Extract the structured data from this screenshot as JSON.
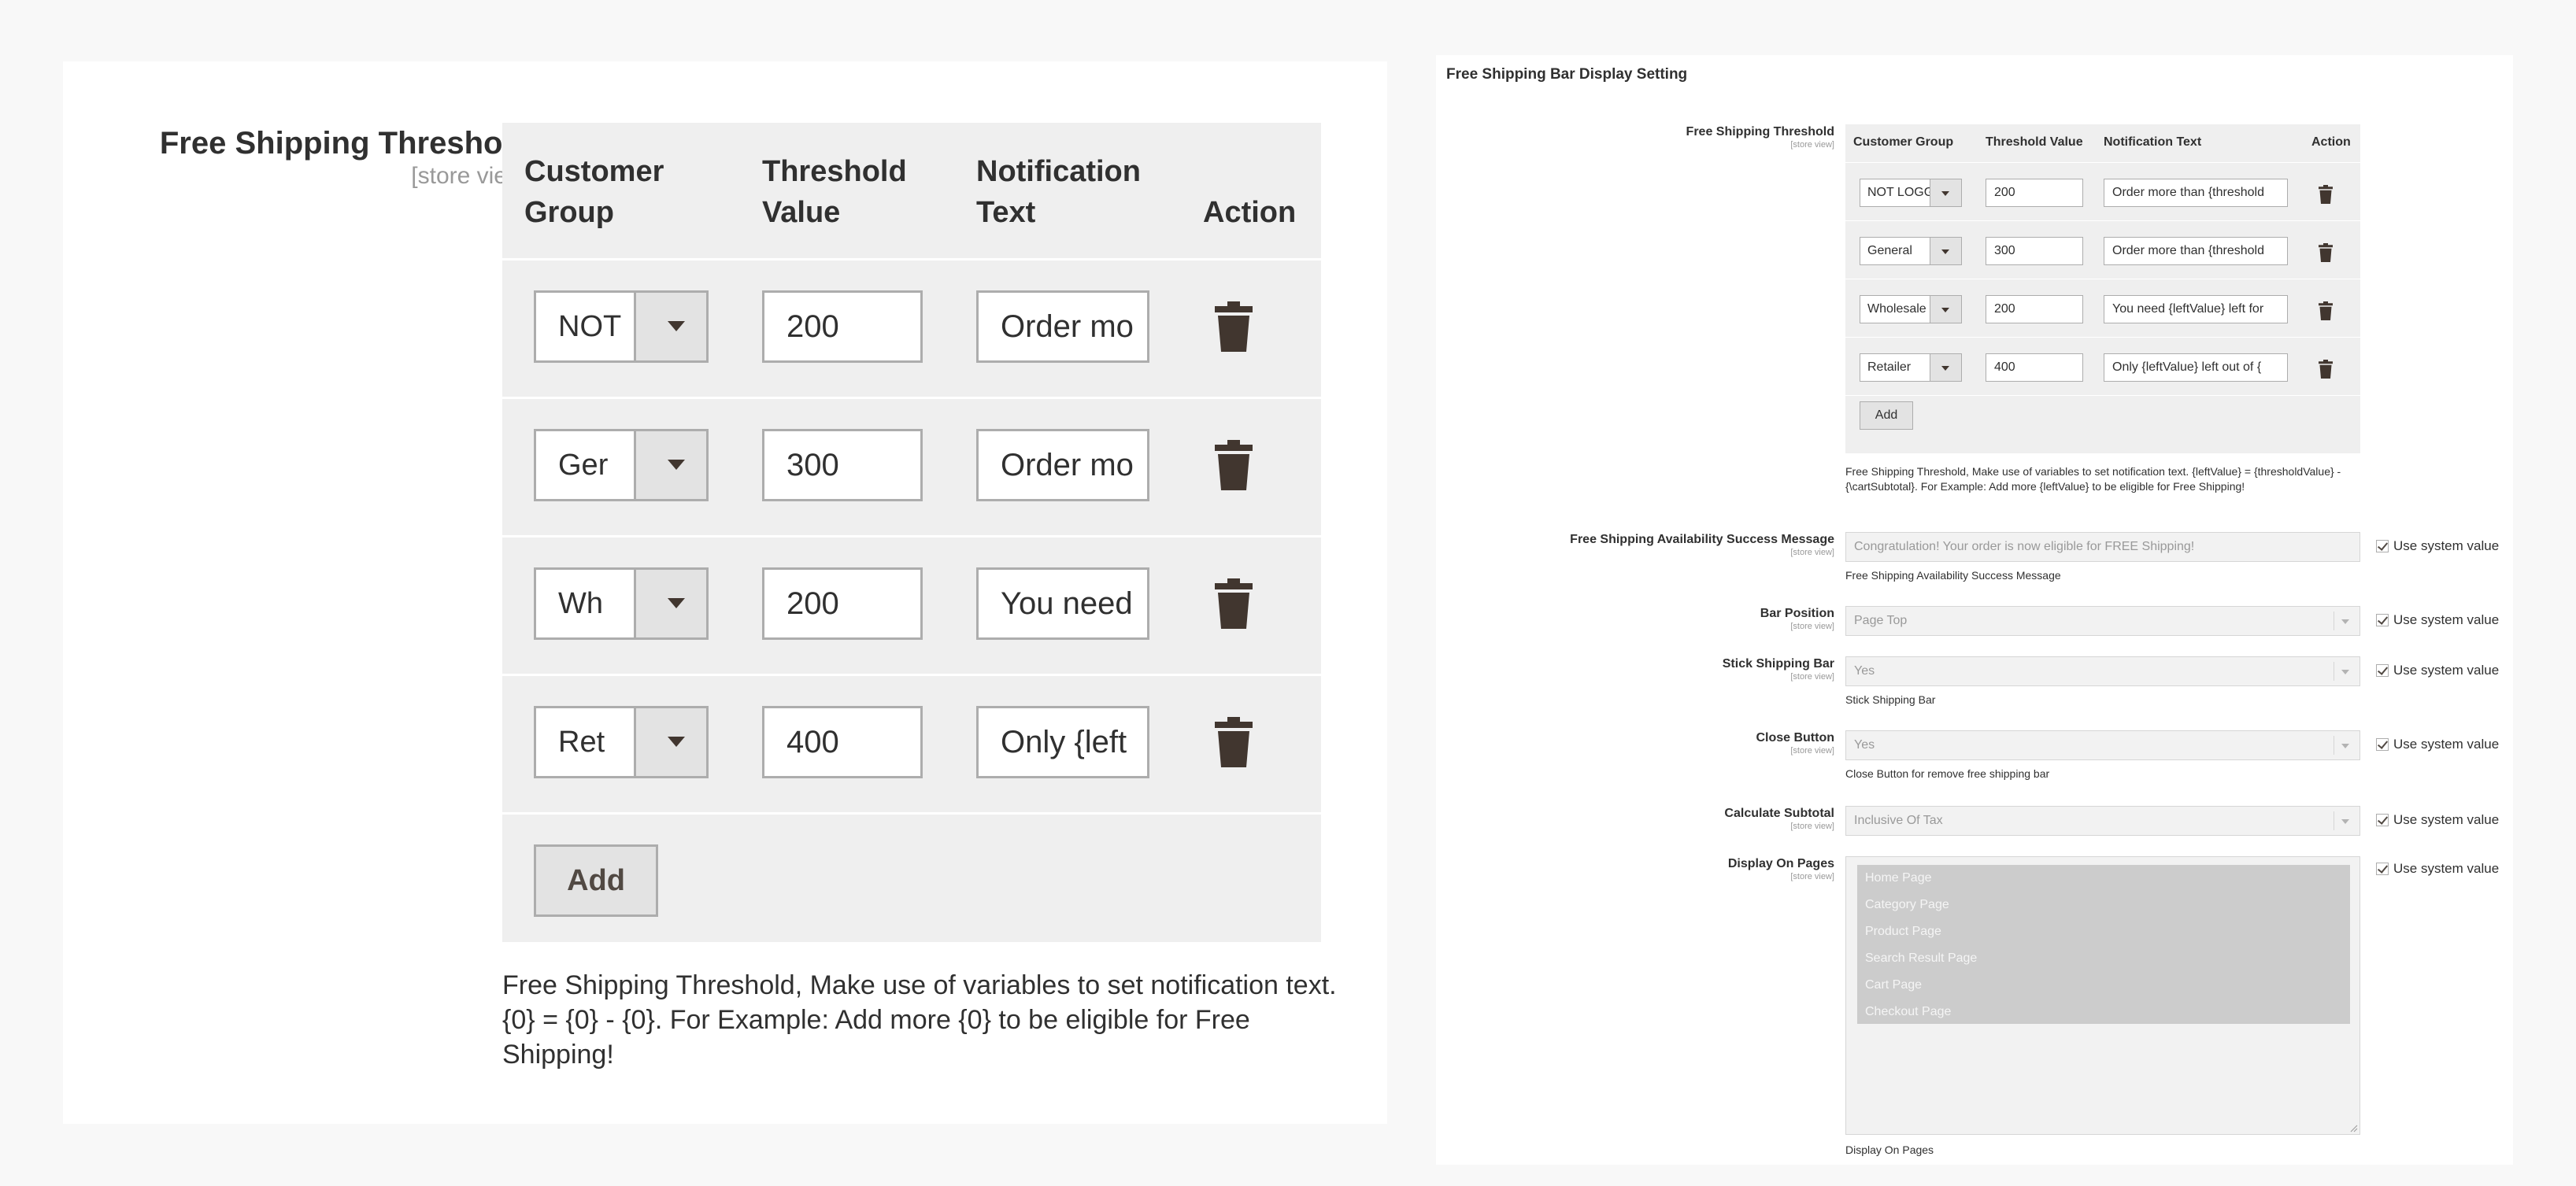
{
  "zoom": {
    "label": "Free Shipping Threshold",
    "scope": "[store view]",
    "headers": [
      "Customer Group",
      "Threshold Value",
      "Notification Text",
      "Action"
    ],
    "rows": [
      {
        "group": "NOT",
        "value": "200",
        "text": "Order mo"
      },
      {
        "group": "Ger",
        "value": "300",
        "text": "Order mo"
      },
      {
        "group": "Wh",
        "value": "200",
        "text": "You need"
      },
      {
        "group": "Ret",
        "value": "400",
        "text": "Only {left"
      }
    ],
    "add_label": "Add",
    "note": "Free Shipping Threshold, Make use of variables to set notification text. {0} = {0} - {0}. For Example: Add more {0} to be eligible for Free Shipping!"
  },
  "config": {
    "title": "Free Shipping Bar Display Setting",
    "scope": "[store view]",
    "threshold": {
      "label": "Free Shipping Threshold",
      "headers": [
        "Customer Group",
        "Threshold Value",
        "Notification Text",
        "Action"
      ],
      "rows": [
        {
          "group": "NOT LOGGED IN",
          "value": "200",
          "text": "Order more than {threshold"
        },
        {
          "group": "General",
          "value": "300",
          "text": "Order more than {threshold"
        },
        {
          "group": "Wholesale",
          "value": "200",
          "text": "You need {leftValue} left for"
        },
        {
          "group": "Retailer",
          "value": "400",
          "text": "Only {leftValue} left out of {"
        }
      ],
      "add_label": "Add",
      "note": "Free Shipping Threshold, Make use of variables to set notification text. {leftValue} = {thresholdValue} - {\\cartSubtotal}. For Example: Add more {leftValue} to be eligible for Free Shipping!"
    },
    "success_message": {
      "label": "Free Shipping Availability Success Message",
      "value": "Congratulation! Your order is now eligible for FREE Shipping!",
      "note": "Free Shipping Availability Success Message"
    },
    "bar_position": {
      "label": "Bar Position",
      "value": "Page Top"
    },
    "stick_bar": {
      "label": "Stick Shipping Bar",
      "value": "Yes",
      "note": "Stick Shipping Bar"
    },
    "close_button": {
      "label": "Close Button",
      "value": "Yes",
      "note": "Close Button for remove free shipping bar"
    },
    "calc_subtotal": {
      "label": "Calculate Subtotal",
      "value": "Inclusive Of Tax"
    },
    "display_pages": {
      "label": "Display On Pages",
      "options": [
        "Home Page",
        "Category Page",
        "Product Page",
        "Search Result Page",
        "Cart Page",
        "Checkout Page"
      ],
      "note": "Display On Pages"
    },
    "use_system_value": "Use system value"
  }
}
